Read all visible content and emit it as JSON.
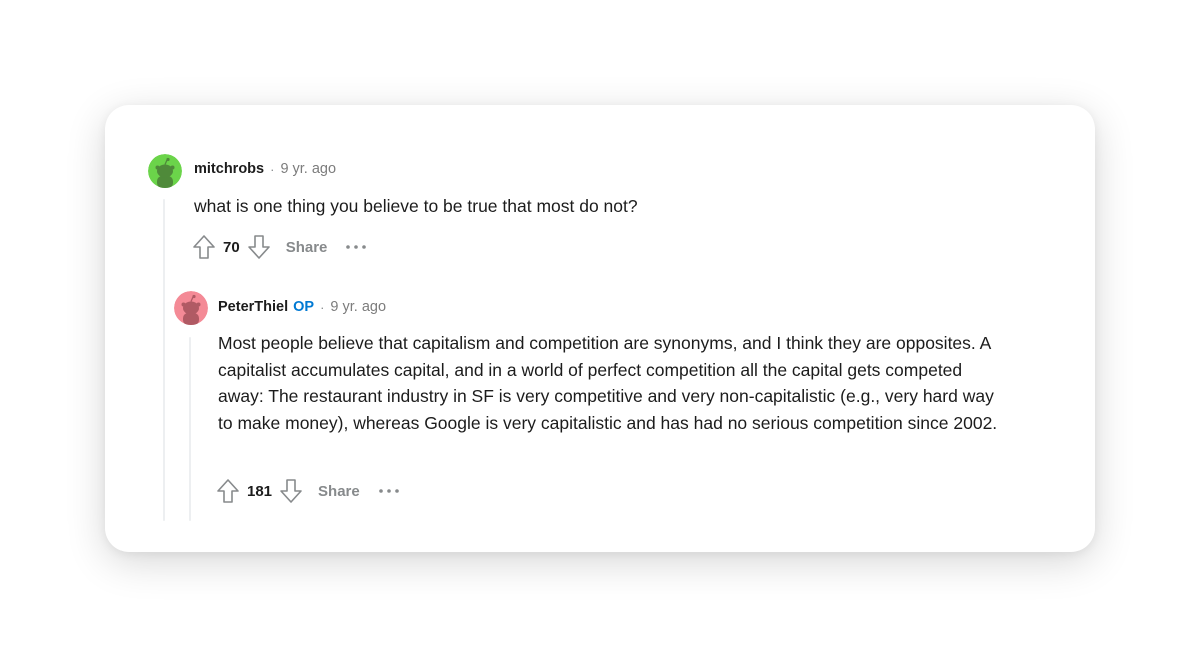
{
  "comments": [
    {
      "username": "mitchrobs",
      "separator": "·",
      "timestamp": "9 yr. ago",
      "avatar_color": "#6bd44a",
      "body": "what is one thing you believe to be true that most do not?",
      "votes": "70",
      "share_label": "Share",
      "upvote_icon": "arrow-up-icon",
      "downvote_icon": "arrow-down-icon",
      "more_icon": "ellipsis-icon"
    },
    {
      "username": "PeterThiel",
      "op_badge": "OP",
      "separator": "·",
      "timestamp": "9 yr. ago",
      "avatar_color": "#f48a96",
      "body": "Most people believe that capitalism and competition are synonyms, and I think they are opposites. A capitalist accumulates capital, and in a world of perfect competition all the capital gets competed away: The restaurant industry in SF is very competitive and very non-capitalistic (e.g., very hard way to make money), whereas Google is very capitalistic and has had no serious competition since 2002.",
      "votes": "181",
      "share_label": "Share",
      "upvote_icon": "arrow-up-icon",
      "downvote_icon": "arrow-down-icon",
      "more_icon": "ellipsis-icon"
    }
  ],
  "colors": {
    "accent_op": "#0079d3",
    "muted": "#878a8c",
    "text": "#1c1c1c",
    "thread_line": "#edeff1"
  }
}
